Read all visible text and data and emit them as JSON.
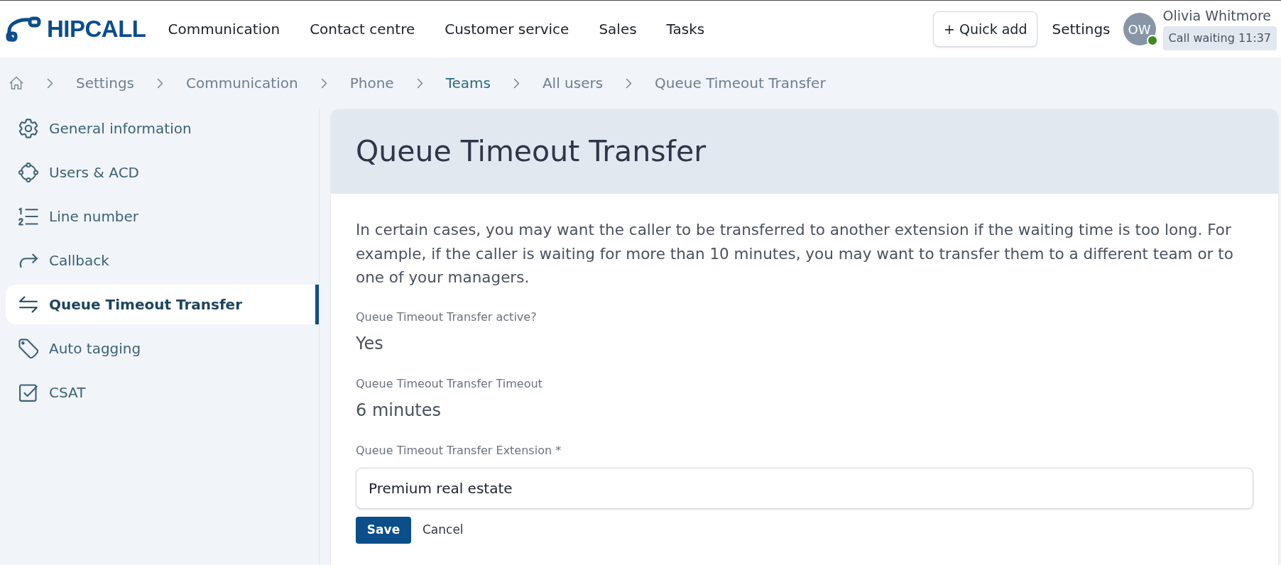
{
  "header": {
    "brand": "HIPCALL",
    "nav": [
      "Communication",
      "Contact centre",
      "Customer service",
      "Sales",
      "Tasks"
    ],
    "quick_add": "+ Quick add",
    "settings": "Settings",
    "user": {
      "initials": "OW",
      "name": "Olivia Whitmore",
      "status": "Call waiting 11:37",
      "online": true
    }
  },
  "breadcrumb": [
    {
      "label": "Settings",
      "highlighted": false
    },
    {
      "label": "Communication",
      "highlighted": false
    },
    {
      "label": "Phone",
      "highlighted": false
    },
    {
      "label": "Teams",
      "highlighted": true
    },
    {
      "label": "All users",
      "highlighted": false
    },
    {
      "label": "Queue Timeout Transfer",
      "highlighted": false
    }
  ],
  "sidebar": {
    "items": [
      {
        "label": "General information",
        "selected": false
      },
      {
        "label": "Users & ACD",
        "selected": false
      },
      {
        "label": "Line number",
        "selected": false
      },
      {
        "label": "Callback",
        "selected": false
      },
      {
        "label": "Queue Timeout Transfer",
        "selected": true
      },
      {
        "label": "Auto tagging",
        "selected": false
      },
      {
        "label": "CSAT",
        "selected": false
      }
    ]
  },
  "page": {
    "title": "Queue Timeout Transfer",
    "description": "In certain cases, you may want the caller to be transferred to another extension if the waiting time is too long. For example, if the caller is waiting for more than 10 minutes, you may want to transfer them to a different team or to one of your managers.",
    "fields": [
      {
        "kind": "readonly",
        "label": "Queue Timeout Transfer active?",
        "value": "Yes"
      },
      {
        "kind": "readonly",
        "label": "Queue Timeout Transfer Timeout",
        "value": "6 minutes"
      },
      {
        "kind": "input",
        "label": "Queue Timeout Transfer Extension *",
        "value": "Premium real estate"
      }
    ],
    "buttons": [
      {
        "kind": "primary",
        "label": "Save"
      },
      {
        "kind": "link",
        "label": "Cancel"
      }
    ]
  }
}
